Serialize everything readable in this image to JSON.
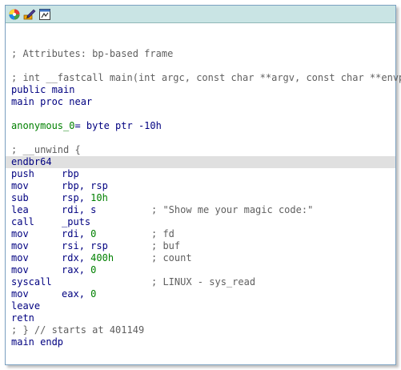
{
  "toolbar": {
    "buttons": [
      {
        "icon": "graph-overview-icon"
      },
      {
        "icon": "edit-color-icon"
      },
      {
        "icon": "graph-layout-icon"
      }
    ]
  },
  "listing": {
    "attributes_comment": "; Attributes: bp-based frame",
    "prototype_comment": "; int __fastcall main(int argc, const char **argv, const char **envp)",
    "public_line": "public main",
    "proc_line": "main proc near",
    "var_name": "anonymous_0",
    "var_def": "= byte ptr -10h",
    "unwind_comment": "; __unwind {",
    "instructions": [
      {
        "mnemonic": "endbr64",
        "operands": [],
        "comment": ""
      },
      {
        "mnemonic": "push",
        "operands": [
          {
            "t": "rbp",
            "k": "reg"
          }
        ],
        "comment": ""
      },
      {
        "mnemonic": "mov",
        "operands": [
          {
            "t": "rbp",
            "k": "reg"
          },
          {
            "t": ", ",
            "k": "reg"
          },
          {
            "t": "rsp",
            "k": "reg"
          }
        ],
        "comment": ""
      },
      {
        "mnemonic": "sub",
        "operands": [
          {
            "t": "rsp",
            "k": "reg"
          },
          {
            "t": ", ",
            "k": "reg"
          },
          {
            "t": "10h",
            "k": "num"
          }
        ],
        "comment": ""
      },
      {
        "mnemonic": "lea",
        "operands": [
          {
            "t": "rdi",
            "k": "reg"
          },
          {
            "t": ", ",
            "k": "reg"
          },
          {
            "t": "s",
            "k": "reg"
          }
        ],
        "comment": "; \"Show me your magic code:\""
      },
      {
        "mnemonic": "call",
        "operands": [
          {
            "t": "_puts",
            "k": "reg"
          }
        ],
        "comment": ""
      },
      {
        "mnemonic": "mov",
        "operands": [
          {
            "t": "rdi",
            "k": "reg"
          },
          {
            "t": ", ",
            "k": "reg"
          },
          {
            "t": "0",
            "k": "num"
          }
        ],
        "comment": "; fd"
      },
      {
        "mnemonic": "mov",
        "operands": [
          {
            "t": "rsi",
            "k": "reg"
          },
          {
            "t": ", ",
            "k": "reg"
          },
          {
            "t": "rsp",
            "k": "reg"
          }
        ],
        "comment": "; buf"
      },
      {
        "mnemonic": "mov",
        "operands": [
          {
            "t": "rdx",
            "k": "reg"
          },
          {
            "t": ", ",
            "k": "reg"
          },
          {
            "t": "400h",
            "k": "num"
          }
        ],
        "comment": "; count"
      },
      {
        "mnemonic": "mov",
        "operands": [
          {
            "t": "rax",
            "k": "reg"
          },
          {
            "t": ", ",
            "k": "reg"
          },
          {
            "t": "0",
            "k": "num"
          }
        ],
        "comment": ""
      },
      {
        "mnemonic": "syscall",
        "operands": [],
        "comment": "; LINUX - sys_read"
      },
      {
        "mnemonic": "mov",
        "operands": [
          {
            "t": "eax",
            "k": "reg"
          },
          {
            "t": ", ",
            "k": "reg"
          },
          {
            "t": "0",
            "k": "num"
          }
        ],
        "comment": ""
      },
      {
        "mnemonic": "leave",
        "operands": [],
        "comment": ""
      },
      {
        "mnemonic": "retn",
        "operands": [],
        "comment": ""
      }
    ],
    "end_unwind_comment": "; } // starts at 401149",
    "endp_line": "main endp"
  },
  "colors": {
    "title_bar": "#c9e4e4",
    "border": "#7aa0c0",
    "code_text": "#000080",
    "comment_text": "#5f5f5f",
    "number_text": "#008000",
    "highlight_line": "#e0e0e0"
  }
}
